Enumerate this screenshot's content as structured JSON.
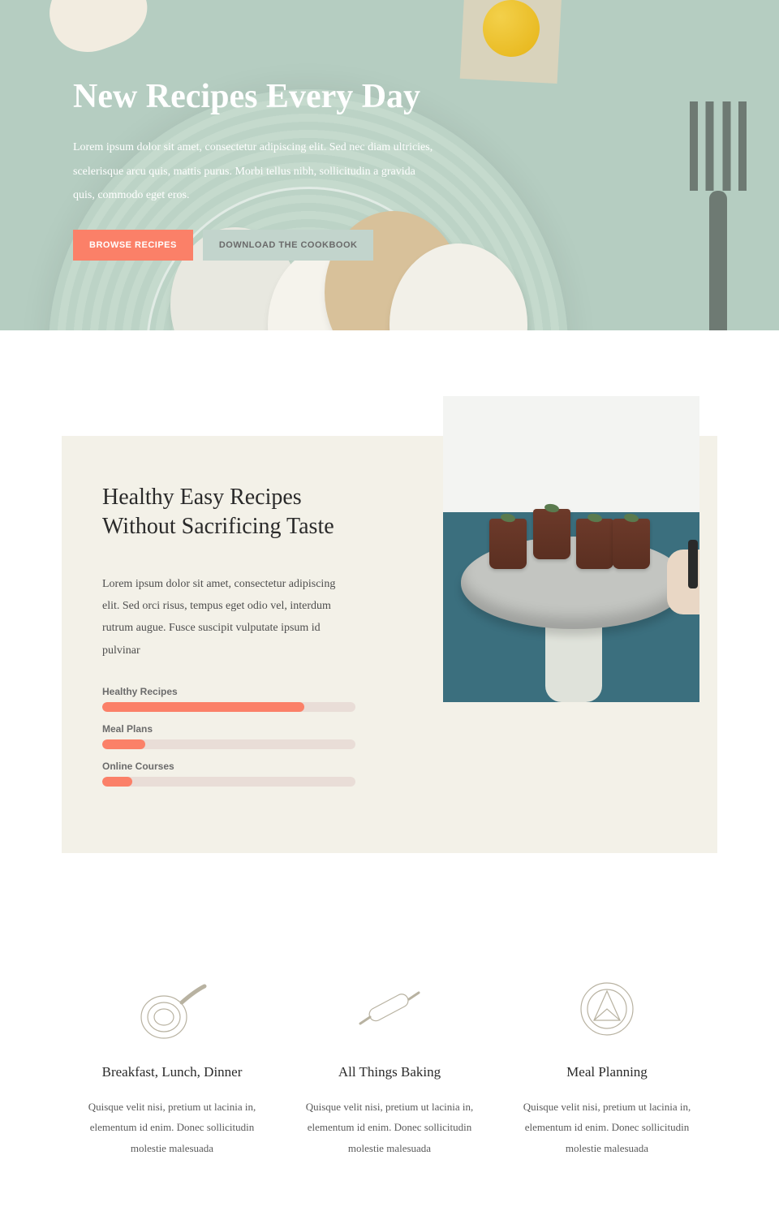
{
  "hero": {
    "title": "New Recipes Every Day",
    "description": "Lorem ipsum dolor sit amet, consectetur adipiscing elit. Sed nec diam ultricies, scelerisque arcu quis, mattis purus. Morbi tellus nibh, sollicitudin a gravida quis, commodo eget eros.",
    "browse_label": "BROWSE RECIPES",
    "download_label": "DOWNLOAD THE COOKBOOK"
  },
  "panel": {
    "heading": "Healthy Easy Recipes Without Sacrificing Taste",
    "body": "Lorem ipsum dolor sit amet, consectetur adipiscing elit. Sed orci risus, tempus eget odio vel, interdum rutrum augue. Fusce suscipit vulputate ipsum id pulvinar",
    "bars": [
      {
        "label": "Healthy Recipes",
        "pct": 80
      },
      {
        "label": "Meal Plans",
        "pct": 17
      },
      {
        "label": "Online Courses",
        "pct": 12
      }
    ]
  },
  "features": [
    {
      "title": "Breakfast, Lunch, Dinner",
      "desc": "Quisque velit nisi, pretium ut lacinia in, elementum id enim. Donec sollicitudin molestie malesuada"
    },
    {
      "title": "All Things Baking",
      "desc": "Quisque velit nisi, pretium ut lacinia in, elementum id enim. Donec sollicitudin molestie malesuada"
    },
    {
      "title": "Meal Planning",
      "desc": "Quisque velit nisi, pretium ut lacinia in, elementum id enim. Donec sollicitudin molestie malesuada"
    }
  ],
  "chart_data": {
    "type": "bar",
    "categories": [
      "Healthy Recipes",
      "Meal Plans",
      "Online Courses"
    ],
    "values": [
      80,
      17,
      12
    ],
    "title": "",
    "xlabel": "",
    "ylabel": "",
    "ylim": [
      0,
      100
    ]
  }
}
